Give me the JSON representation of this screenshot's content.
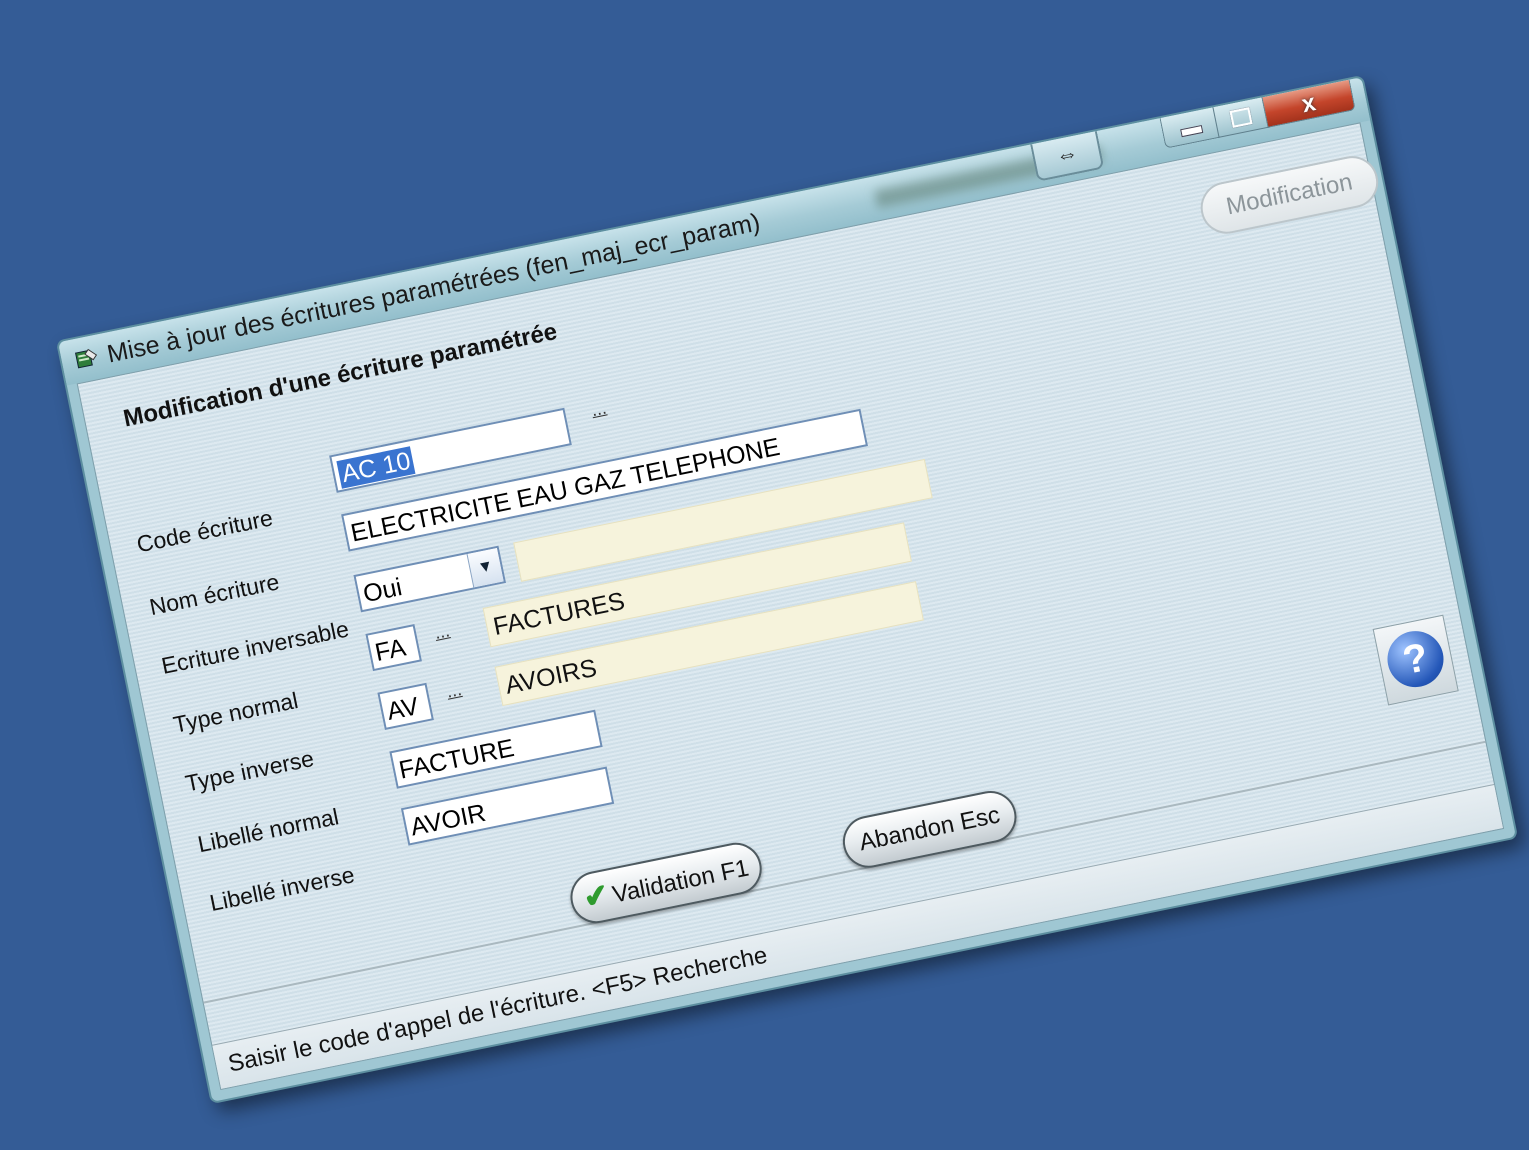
{
  "window": {
    "title": "Mise à jour des écritures paramétrées (fen_maj_ecr_param)",
    "resize_glyph": "⇔",
    "close_glyph": "x"
  },
  "form": {
    "heading": "Modification d'une écriture paramétrée",
    "mode_button": "Modification",
    "ellipsis": "...",
    "fields": {
      "code_label": "Code écriture",
      "code_value": "AC 10",
      "nom_label": "Nom écriture",
      "nom_value": "ELECTRICITE EAU GAZ TELEPHONE",
      "inversable_label": "Ecriture inversable",
      "inversable_value": "Oui",
      "type_normal_label": "Type normal",
      "type_normal_code": "FA",
      "type_normal_desc": "FACTURES",
      "type_inverse_label": "Type inverse",
      "type_inverse_code": "AV",
      "type_inverse_desc": "AVOIRS",
      "libelle_normal_label": "Libellé normal",
      "libelle_normal_value": "FACTURE",
      "libelle_inverse_label": "Libellé inverse",
      "libelle_inverse_value": "AVOIR"
    }
  },
  "buttons": {
    "validate": "Validation F1",
    "cancel": "Abandon Esc",
    "help_glyph": "?"
  },
  "status": {
    "text": "Saisir le code d'appel de l'écriture. <F5> Recherche"
  },
  "icons": [
    "app-icon",
    "resize-icon",
    "minimize-icon",
    "maximize-icon",
    "close-icon",
    "dropdown-arrow-icon",
    "checkmark-icon",
    "help-icon"
  ],
  "colors": {
    "desktop": "#345c96",
    "close_button": "#c4452b",
    "selection": "#3a74d0",
    "readonly_field": "#f6f3dc"
  }
}
